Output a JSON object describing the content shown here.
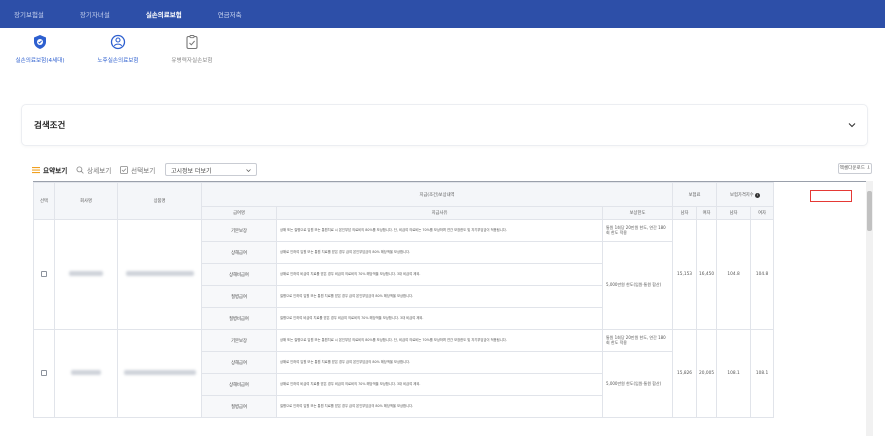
{
  "topnav": {
    "tabs": [
      {
        "label": "장기보험설",
        "active": false
      },
      {
        "label": "장기자녀설",
        "active": false
      },
      {
        "label": "실손의료보험",
        "active": true
      },
      {
        "label": "연금저축",
        "active": false
      }
    ]
  },
  "icons": [
    {
      "label": "실손의료보험(4세대)",
      "icon": "shield-icon",
      "active": true
    },
    {
      "label": "노후실손의료보험",
      "icon": "elder-icon",
      "active": true
    },
    {
      "label": "유병력자실손보험",
      "icon": "clipboard-icon",
      "active": false
    }
  ],
  "search": {
    "title": "검색조건"
  },
  "toolbar": {
    "summary": "요약보기",
    "detail": "상세보기",
    "selected": "선택보기",
    "select_value": "고시정보 더보기",
    "excel": "엑셀다운로드"
  },
  "table": {
    "headers": {
      "select": "선택",
      "company": "회사명",
      "product": "상품명",
      "payment": "지급(조건)보상내역",
      "benefit": "급여명",
      "condition": "지급사유",
      "limit": "보상한도",
      "premium": "보험료",
      "index": "보험가격지수",
      "male": "남자",
      "female": "여자"
    },
    "groups": [
      {
        "rows": [
          {
            "benefit": "기본보장",
            "condition": "상해 또는 질병으로 입원 또는 통원치료 시 본인부담 의료비의 80%를 보상합니다. 단, 비급여 의료비는 70%를 보상하며 연간 보장한도 및 자기부담금이 적용됩니다."
          },
          {
            "benefit": "상해급여",
            "condition": "상해로 인하여 입원 또는 통원 치료를 받은 경우 급여 본인부담금의 80% 해당액을 보상합니다."
          },
          {
            "benefit": "상해비급여",
            "condition": "상해로 인하여 비급여 치료를 받은 경우 비급여 의료비의 70% 해당액을 보상합니다. 3대 비급여 제외."
          },
          {
            "benefit": "질병급여",
            "condition": "질병으로 인하여 입원 또는 통원 치료를 받은 경우 급여 본인부담금의 80% 해당액을 보상합니다."
          },
          {
            "benefit": "질병비급여",
            "condition": "질병으로 인하여 비급여 치료를 받은 경우 비급여 의료비의 70% 해당액을 보상합니다. 3대 비급여 제외."
          }
        ],
        "limit": "5,000만원 한도(입원·통원 합산)",
        "limit_top": "통원 1회당 20만원 한도, 연간 180회 한도 적용",
        "premium_male": "15,153",
        "premium_female": "16,450",
        "index_male": "104.8",
        "index_female": "104.8"
      },
      {
        "rows": [
          {
            "benefit": "기본보장",
            "condition": "상해 또는 질병으로 입원 또는 통원치료 시 본인부담 의료비의 80%를 보상합니다. 단, 비급여 의료비는 70%를 보상하며 연간 보장한도 및 자기부담금이 적용됩니다."
          },
          {
            "benefit": "상해급여",
            "condition": "상해로 인하여 입원 또는 통원 치료를 받은 경우 급여 본인부담금의 80% 해당액을 보상합니다."
          },
          {
            "benefit": "상해비급여",
            "condition": "상해로 인하여 비급여 치료를 받은 경우 비급여 의료비의 70% 해당액을 보상합니다. 3대 비급여 제외."
          },
          {
            "benefit": "질병급여",
            "condition": "질병으로 인하여 입원 또는 통원 치료를 받은 경우 급여 본인부담금의 80% 해당액을 보상합니다."
          }
        ],
        "limit": "5,000만원 한도(입원·통원 합산)",
        "limit_top": "통원 1회당 20만원 한도, 연간 180회 한도 적용",
        "premium_male": "15,826",
        "premium_female": "20,005",
        "index_male": "108.1",
        "index_female": "108.1"
      }
    ]
  },
  "colors": {
    "nav": "#2d4fa8",
    "accent": "#2d5fcf",
    "highlight": "#e53935"
  }
}
